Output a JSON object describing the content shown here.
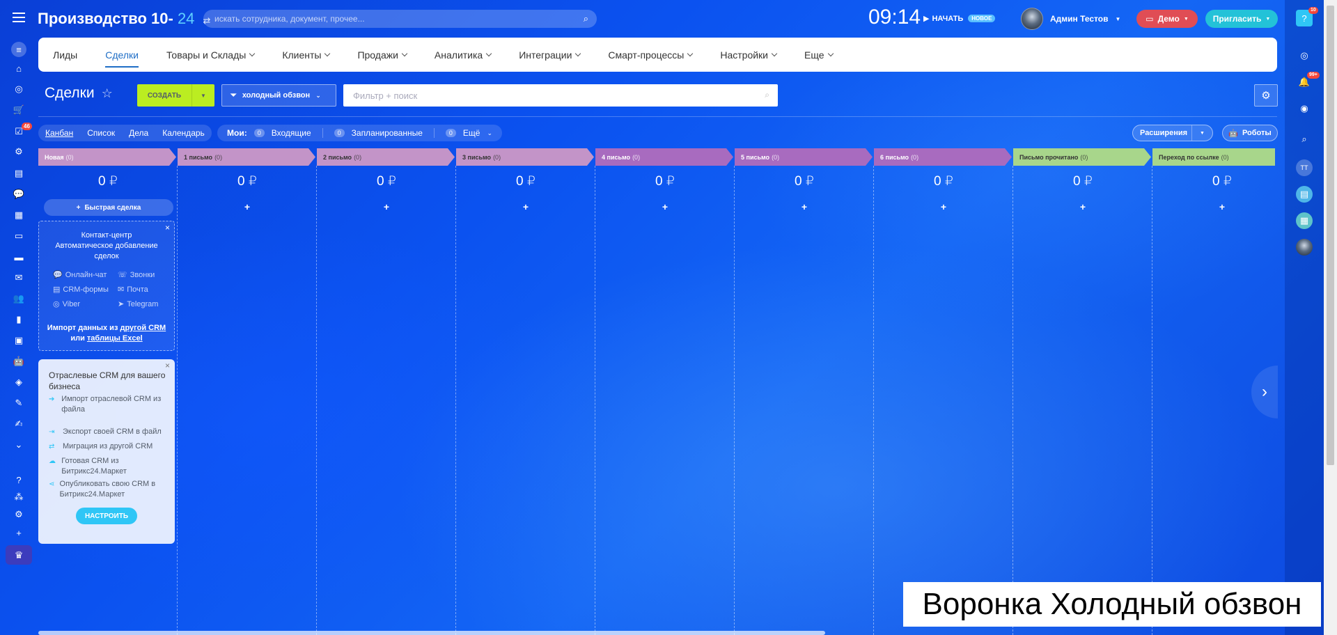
{
  "app": {
    "logo_main": "Производство 10-",
    "logo_num": "24",
    "search_placeholder": "искать сотрудника, документ, прочее...",
    "clock": "09:14",
    "start_label": "НАЧАТЬ",
    "new_badge": "НОВОЕ",
    "user_name": "Админ Тестов",
    "demo_label": "Демо",
    "invite_label": "Пригласить"
  },
  "left_sidebar": {
    "badges": {
      "tasks": "46"
    }
  },
  "right_sidebar": {
    "help_badge": "10",
    "notif_badge": "99+",
    "avatar_initials": "ТТ"
  },
  "topnav": [
    {
      "label": "Лиды",
      "dropdown": false,
      "active": false
    },
    {
      "label": "Сделки",
      "dropdown": false,
      "active": true
    },
    {
      "label": "Товары и Склады",
      "dropdown": true
    },
    {
      "label": "Клиенты",
      "dropdown": true
    },
    {
      "label": "Продажи",
      "dropdown": true
    },
    {
      "label": "Аналитика",
      "dropdown": true
    },
    {
      "label": "Интеграции",
      "dropdown": true
    },
    {
      "label": "Смарт-процессы",
      "dropdown": true
    },
    {
      "label": "Настройки",
      "dropdown": true
    },
    {
      "label": "Еще",
      "dropdown": true
    }
  ],
  "page": {
    "title": "Сделки",
    "create_label": "СОЗДАТЬ",
    "pipeline_label": "холодный обзвон",
    "filter_placeholder": "Фильтр + поиск"
  },
  "views": [
    {
      "label": "Канбан",
      "active": true
    },
    {
      "label": "Список"
    },
    {
      "label": "Дела"
    },
    {
      "label": "Календарь"
    }
  ],
  "mine": {
    "label": "Мои:",
    "items": [
      {
        "count": "0",
        "label": "Входящие"
      },
      {
        "count": "0",
        "label": "Запланированные"
      },
      {
        "count": "0",
        "label": "Ещё"
      }
    ]
  },
  "toolbar": {
    "extensions_label": "Расширения",
    "robots_label": "Роботы"
  },
  "colors": {
    "stage_pink": "#c394c8",
    "stage_purple": "#a86bbf",
    "stage_green": "#a8d68b",
    "create_btn": "#bbed21"
  },
  "kanban": {
    "columns": [
      {
        "name": "Новая",
        "count": "(0)",
        "sum": "0 ₽",
        "color": "#c394c8",
        "light": false
      },
      {
        "name": "1 письмо",
        "count": "(0)",
        "sum": "0 ₽",
        "color": "#c394c8",
        "light": true
      },
      {
        "name": "2 письмо",
        "count": "(0)",
        "sum": "0 ₽",
        "color": "#c394c8",
        "light": true
      },
      {
        "name": "3 письмо",
        "count": "(0)",
        "sum": "0 ₽",
        "color": "#c394c8",
        "light": true
      },
      {
        "name": "4 письмо",
        "count": "(0)",
        "sum": "0 ₽",
        "color": "#a86bbf",
        "light": false
      },
      {
        "name": "5 письмо",
        "count": "(0)",
        "sum": "0 ₽",
        "color": "#a86bbf",
        "light": false
      },
      {
        "name": "6 письмо",
        "count": "(0)",
        "sum": "0 ₽",
        "color": "#a86bbf",
        "light": false
      },
      {
        "name": "Письмо прочитано",
        "count": "(0)",
        "sum": "0 ₽",
        "color": "#a8d68b",
        "light": true
      },
      {
        "name": "Переход по ссылке",
        "count": "(0)",
        "sum": "0 ₽",
        "color": "#a8d68b",
        "light": true
      }
    ],
    "fast_deal_label": "Быстрая сделка",
    "plus_label": "+"
  },
  "contact_center": {
    "title_1": "Контакт-центр",
    "title_2": "Автоматическое добавление",
    "title_3": "сделок",
    "channels": [
      "Онлайн-чат",
      "Звонки",
      "CRM-формы",
      "Почта",
      "Viber",
      "Telegram"
    ],
    "import_text_1": "Импорт данных из",
    "import_link_1": "другой CRM",
    "import_text_2": "или",
    "import_link_2": "таблицы Excel"
  },
  "industry": {
    "title": "Отраслевые CRM для вашего бизнеса",
    "items": [
      "Импорт отраслевой CRM из файла",
      "Экспорт своей CRM в файл",
      "Миграция из другой CRM",
      "Готовая CRM из Битрикс24.Маркет",
      "Опубликовать свою CRM в Битрикс24.Маркет"
    ],
    "button": "НАСТРОИТЬ"
  },
  "caption": "Воронка Холодный обзвон"
}
